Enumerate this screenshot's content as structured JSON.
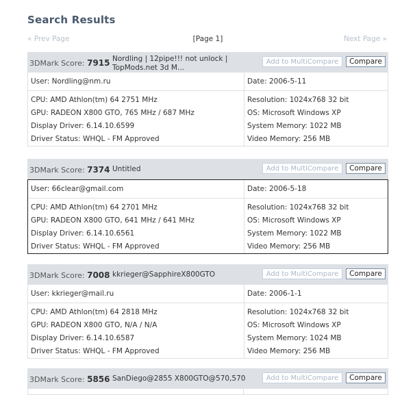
{
  "title": "Search Results",
  "pager": {
    "prev": "« Prev Page",
    "current": "[Page 1]",
    "next": "Next Page »"
  },
  "buttons": {
    "multicompare": "Add to MultiCompare",
    "compare": "Compare"
  },
  "score_label": "3DMark Score:",
  "results": [
    {
      "score": "7915",
      "name": "Nordling | 12pipe!!! not unlock | TopMods.net 3d M...",
      "user": "User: Nordling@nm.ru",
      "date": "Date: 2006-5-11",
      "cpu": "CPU: AMD Athlon(tm) 64 2751 MHz",
      "gpu": "GPU: RADEON X800 GTO, 765 MHz / 687 MHz",
      "driver": "Display Driver: 6.14.10.6599",
      "status": "Driver Status: WHQL - FM Approved",
      "resolution": "Resolution: 1024x768 32 bit",
      "os": "OS: Microsoft Windows XP",
      "memory": "System Memory: 1022 MB",
      "video": "Video Memory: 256 MB"
    },
    {
      "score": "7374",
      "name": "Untitled",
      "user": "User: 66clear@gmail.com",
      "date": "Date: 2006-5-18",
      "cpu": "CPU: AMD Athlon(tm) 64 2701 MHz",
      "gpu": "GPU: RADEON X800 GTO, 641 MHz / 641 MHz",
      "driver": "Display Driver: 6.14.10.6561",
      "status": "Driver Status: WHQL - FM Approved",
      "resolution": "Resolution: 1024x768 32 bit",
      "os": "OS: Microsoft Windows XP",
      "memory": "System Memory: 1022 MB",
      "video": "Video Memory: 256 MB"
    },
    {
      "score": "7008",
      "name": "kkrieger@SapphireX800GTO",
      "user": "User: kkrieger@mail.ru",
      "date": "Date: 2006-1-1",
      "cpu": "CPU: AMD Athlon(tm) 64 2818 MHz",
      "gpu": "GPU: RADEON X800 GTO, N/A / N/A",
      "driver": "Display Driver: 6.14.10.6587",
      "status": "Driver Status: WHQL - FM Approved",
      "resolution": "Resolution: 1024x768 32 bit",
      "os": "OS: Microsoft Windows XP",
      "memory": "System Memory: 1024 MB",
      "video": "Video Memory: 256 MB"
    },
    {
      "score": "5856",
      "name": "SanDiego@2855 X800GTO@570,570"
    }
  ],
  "colors": {
    "header_bg": "#dde1e6",
    "title": "#4a5a6e",
    "disabled_link": "#b8c2cc"
  }
}
